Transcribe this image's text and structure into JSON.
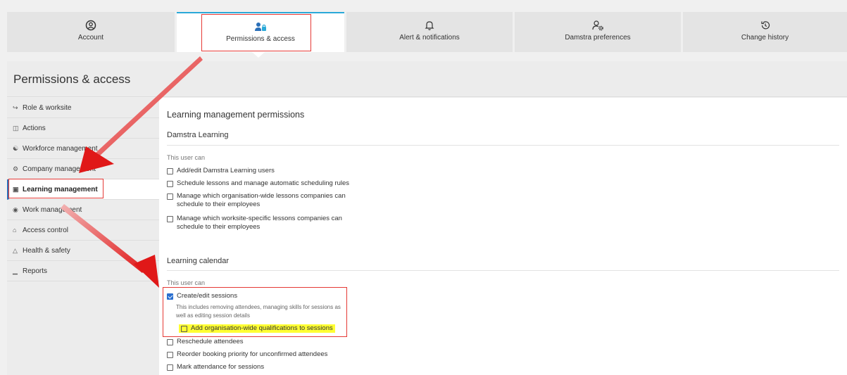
{
  "tabs": [
    {
      "label": "Account",
      "icon": "user-circle-icon",
      "active": false
    },
    {
      "label": "Permissions & access",
      "icon": "user-lock-icon",
      "active": true
    },
    {
      "label": "Alert & notifications",
      "icon": "bell-icon",
      "active": false
    },
    {
      "label": "Damstra preferences",
      "icon": "user-gear-icon",
      "active": false
    },
    {
      "label": "Change history",
      "icon": "history-icon",
      "active": false
    }
  ],
  "page_title": "Permissions & access",
  "sidebar": {
    "items": [
      {
        "label": "Role & worksite",
        "icon": "signin-icon",
        "active": false
      },
      {
        "label": "Actions",
        "icon": "clipboard-icon",
        "active": false
      },
      {
        "label": "Workforce management",
        "icon": "person-icon",
        "active": false
      },
      {
        "label": "Company management",
        "icon": "company-icon",
        "active": false
      },
      {
        "label": "Learning management",
        "icon": "learning-icon",
        "active": true
      },
      {
        "label": "Work management",
        "icon": "hardhat-icon",
        "active": false
      },
      {
        "label": "Access control",
        "icon": "gate-icon",
        "active": false
      },
      {
        "label": "Health & safety",
        "icon": "hazard-icon",
        "active": false
      },
      {
        "label": "Reports",
        "icon": "chart-icon",
        "active": false
      }
    ]
  },
  "main": {
    "heading": "Learning management permissions",
    "section1": {
      "title": "Damstra Learning",
      "caption": "This user can",
      "items": [
        {
          "label": "Add/edit Damstra Learning users",
          "checked": false
        },
        {
          "label": "Schedule lessons and manage automatic scheduling rules",
          "checked": false
        },
        {
          "label": "Manage which organisation-wide lessons companies can",
          "label2": "schedule to their employees",
          "checked": false
        },
        {
          "label": "Manage which worksite-specific lessons companies can",
          "label2": "schedule to their employees",
          "checked": false
        }
      ]
    },
    "section2": {
      "title": "Learning calendar",
      "caption": "This user can",
      "create_edit": {
        "label": "Create/edit sessions",
        "checked": true,
        "desc1": "This includes removing attendees, managing skills for sessions as",
        "desc2": "well as editing session details"
      },
      "sub_item": {
        "label": "Add organisation-wide qualifications to sessions",
        "checked": false
      },
      "items": [
        {
          "label": "Reschedule attendees",
          "checked": false
        },
        {
          "label": "Reorder booking priority for unconfirmed attendees",
          "checked": false
        },
        {
          "label": "Mark attendance for sessions",
          "checked": false
        }
      ]
    }
  },
  "colors": {
    "accent": "#2aa9d8",
    "annotation": "#e53935",
    "highlight": "#ffff33",
    "checkbox": "#2a6fd0"
  }
}
